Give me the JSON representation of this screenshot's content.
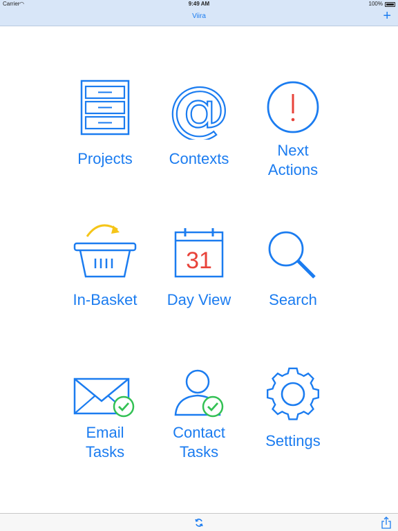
{
  "status_bar": {
    "carrier": "Carrier",
    "time": "9:49 AM",
    "battery": "100%"
  },
  "nav": {
    "title": "Viira",
    "add_label": "+"
  },
  "colors": {
    "accent": "#1b7cf0",
    "alert_red": "#e8433a",
    "arrow_yellow": "#f5c518",
    "check_green": "#33c154"
  },
  "tiles": [
    {
      "label": "Projects",
      "icon": "filing-cabinet-icon"
    },
    {
      "label": "Contexts",
      "icon": "at-sign-icon"
    },
    {
      "label_lines": [
        "Next",
        "Actions"
      ],
      "icon": "exclamation-circle-icon"
    },
    {
      "label": "In-Basket",
      "icon": "basket-icon"
    },
    {
      "label": "Day View",
      "icon": "calendar-icon",
      "calendar_day": "31"
    },
    {
      "label": "Search",
      "icon": "magnifier-icon"
    },
    {
      "label_lines": [
        "Email",
        "Tasks"
      ],
      "icon": "email-check-icon"
    },
    {
      "label_lines": [
        "Contact",
        "Tasks"
      ],
      "icon": "contact-check-icon"
    },
    {
      "label": "Settings",
      "icon": "gear-icon"
    }
  ]
}
